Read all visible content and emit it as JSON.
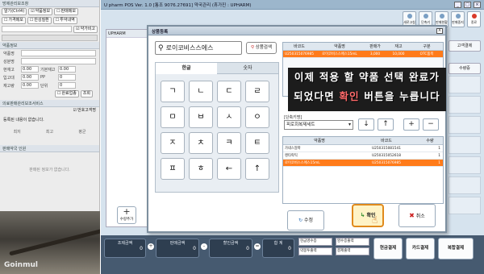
{
  "left": {
    "title": "방제관리보조창",
    "buttons": [
      "알기(Ctrl4)",
      "약품정보",
      "판매메모"
    ],
    "buttons2": [
      "가격메모",
      "만성질환",
      "투약내역"
    ],
    "checkbox": "약가비고",
    "sec2": "약품정보",
    "fields": [
      {
        "label": "약품명",
        "value": ""
      },
      {
        "label": "성분명",
        "value": ""
      },
      {
        "label": "현재고",
        "value": "0.00"
      },
      {
        "label": "입고대",
        "value": "0.00"
      },
      {
        "label": "재고량",
        "value": "0.00"
      }
    ],
    "fields_b": [
      {
        "label": "기본재고",
        "value": "0.00"
      },
      {
        "label": "PP",
        "value": "0"
      },
      {
        "label": "단위",
        "value": "0"
      }
    ],
    "small_btns": [
      "완료업종",
      "조회"
    ],
    "sec3": "의료판매관리보조서비스",
    "check_label": "번호고객명",
    "no_records": "등록된 내용이 없습니다.",
    "mini_headers": [
      "최저",
      "최고",
      "평균"
    ],
    "sec4": "판매약국 인원",
    "empty_text": "판매된 정보가 없습니다.",
    "watermark": "Goinmul"
  },
  "app": {
    "title": "U pharm POS Ver. 1.0 [통조 9076.27691] 약국관리 (휴가진 : UPHARM)",
    "toolbar": [
      "새로고침",
      "단축키",
      "판매현황",
      "판매중지",
      "종료"
    ],
    "left_header": "UPHARM",
    "add_label": "수량추가",
    "right_tabs": [
      "고객결제",
      "수량증"
    ],
    "summary": [
      {
        "label": "조제금액",
        "value": "0"
      },
      {
        "label": "판매금액",
        "value": "0"
      },
      {
        "label": "할인금액",
        "value": "0"
      },
      {
        "label": "합 계",
        "value": "0"
      }
    ],
    "ops": [
      "+",
      "-",
      "="
    ],
    "checks": [
      "현금영수증",
      "영수증출력",
      "약봉투출력",
      "결제출력"
    ],
    "pay_buttons": [
      "현금결제",
      "카드결제",
      "복합결제"
    ]
  },
  "dialog": {
    "title": "상품등록",
    "close": "X",
    "search_value": "로이코비스스에스",
    "search_button": "상품검색",
    "tabs": [
      "한글",
      "숫자"
    ],
    "keys": [
      "ㄱ",
      "ㄴ",
      "ㄷ",
      "ㄹ",
      "ㅁ",
      "ㅂ",
      "ㅅ",
      "ㅇ",
      "ㅈ",
      "ㅊ",
      "ㅋ",
      "ㅌ",
      "ㅍ",
      "ㅎ",
      "←",
      "↑"
    ],
    "top_headers": [
      "바코드",
      "약품명",
      "판매가",
      "재고",
      "구분"
    ],
    "top_rows": [
      [
        "U250315076985",
        "로이코비스스에스15mL",
        "3,000",
        "10,000",
        "OTC품목"
      ]
    ],
    "banner_line1": "이제 적용 할 약품 선택 완료가",
    "banner_line2a": "되었다면 ",
    "banner_line2b": "확인",
    "banner_line2c": " 버튼을 누릅니다",
    "unit_label": "[단축키명]",
    "unit_value": "피로회복제세트",
    "arrows": [
      "↓",
      "↑",
      "+",
      "−"
    ],
    "bottom_headers": [
      "약품명",
      "바코드",
      "수량"
    ],
    "bottom_rows": [
      [
        "가네스알파",
        "U250315081541",
        "1"
      ],
      [
        "렌타락틱",
        "U250315052618",
        "1"
      ],
      [
        "로이코비스스에스15mL",
        "U250315076985",
        "1"
      ]
    ],
    "edit_label": "수정",
    "ok_label": "확인",
    "cancel_label": "취소",
    "colors": {
      "selected_row": "#ff7b1a",
      "highlight_text": "#ff6b6b"
    }
  }
}
